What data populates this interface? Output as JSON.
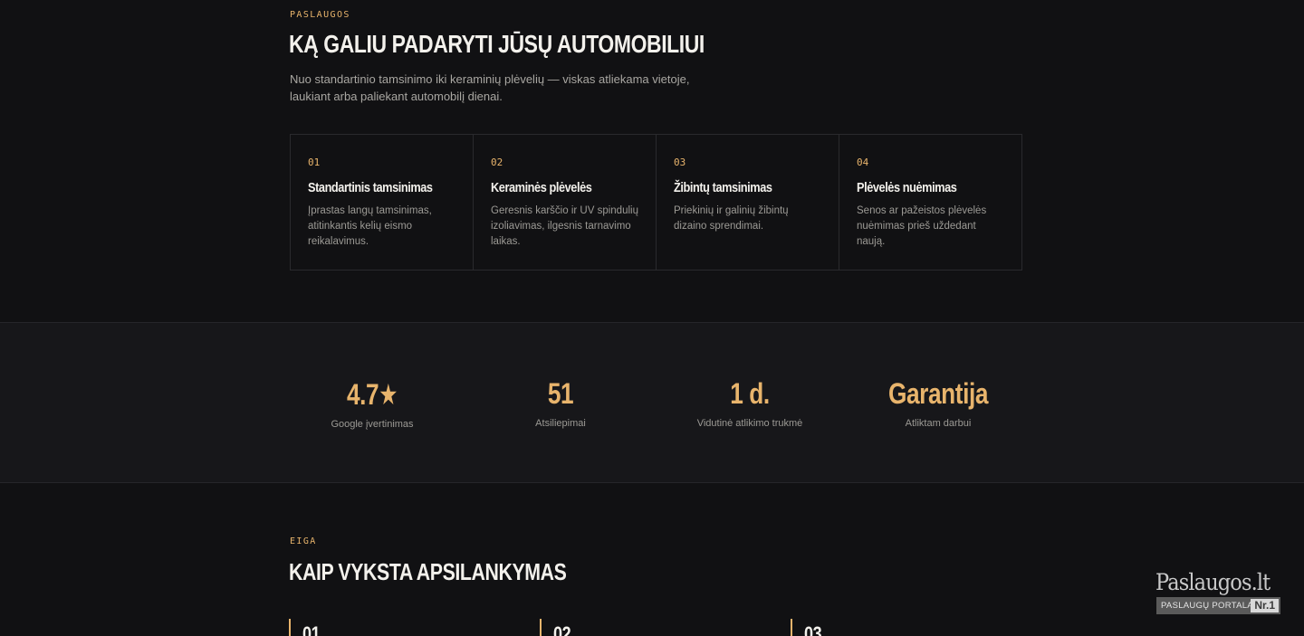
{
  "services": {
    "eyebrow": "PASLAUGOS",
    "title": "KĄ GALIU PADARYTI JŪSŲ AUTOMOBILIUI",
    "lead": "Nuo standartinio tamsinimo iki keraminių plėvelių — viskas atliekama vietoje, laukiant arba paliekant automobilį dienai.",
    "cards": [
      {
        "num": "01",
        "title": "Standartinis tamsinimas",
        "desc": "Įprastas langų tamsinimas, atitinkantis kelių eismo reikalavimus."
      },
      {
        "num": "02",
        "title": "Keraminės plėvelės",
        "desc": "Geresnis karščio ir UV spindulių izoliavimas, ilgesnis tarnavimo laikas."
      },
      {
        "num": "03",
        "title": "Žibintų tamsinimas",
        "desc": "Priekinių ir galinių žibintų dizaino sprendimai."
      },
      {
        "num": "04",
        "title": "Plėvelės nuėmimas",
        "desc": "Senos ar pažeistos plėvelės nuėmimas prieš uždedant naują."
      }
    ]
  },
  "stats": [
    {
      "value": "4.7★",
      "label": "Google įvertinimas"
    },
    {
      "value": "51",
      "label": "Atsiliepimai"
    },
    {
      "value": "1 d.",
      "label": "Vidutinė atlikimo trukmė"
    },
    {
      "value": "Garantija",
      "label": "Atliktam darbui"
    }
  ],
  "process": {
    "eyebrow": "EIGA",
    "title": "KAIP VYKSTA APSILANKYMAS",
    "steps": [
      {
        "num": "01"
      },
      {
        "num": "02"
      },
      {
        "num": "03"
      }
    ]
  },
  "badge": {
    "brand": "Paslaugos.lt",
    "subtitle": "PASLAUGŲ PORTALAS",
    "rank": "Nr.1"
  },
  "colors": {
    "accent": "#e8b46c",
    "background": "#111113",
    "stats_background": "#17171a"
  }
}
